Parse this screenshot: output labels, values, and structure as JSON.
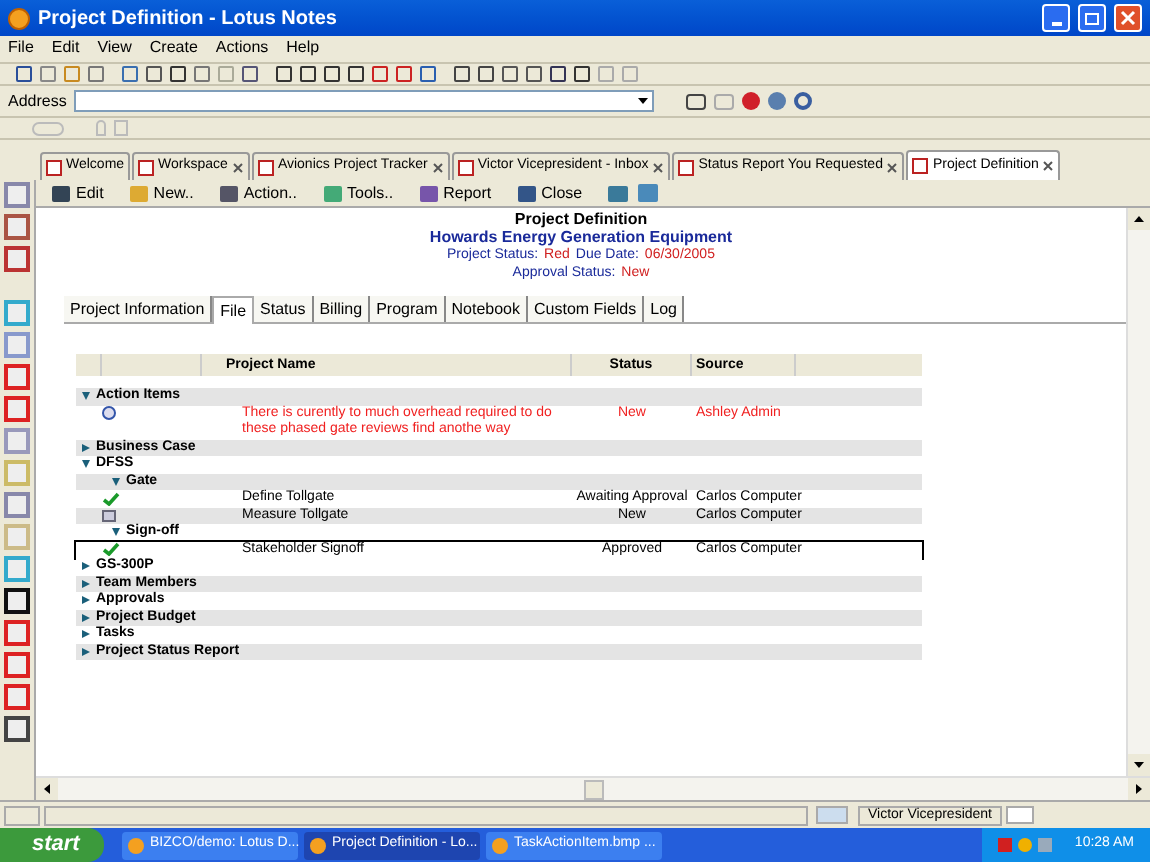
{
  "window": {
    "title": "Project Definition - Lotus Notes"
  },
  "menu": [
    "File",
    "Edit",
    "View",
    "Create",
    "Actions",
    "Help"
  ],
  "address": {
    "label": "Address"
  },
  "tabs": [
    {
      "label": "Welcome",
      "selected": false,
      "closable": false
    },
    {
      "label": "Workspace",
      "selected": false,
      "closable": true
    },
    {
      "label": "Avionics Project Tracker",
      "selected": false,
      "closable": true
    },
    {
      "label": "Victor Vicepresident - Inbox",
      "selected": false,
      "closable": true
    },
    {
      "label": "Status Report You Requested",
      "selected": false,
      "closable": true
    },
    {
      "label": "Project Definition",
      "selected": true,
      "closable": true
    }
  ],
  "actions": [
    {
      "label": "Edit"
    },
    {
      "label": "New.."
    },
    {
      "label": "Action.."
    },
    {
      "label": "Tools.."
    },
    {
      "label": "Report"
    },
    {
      "label": "Close"
    }
  ],
  "document": {
    "title": "Project Definition",
    "subtitle": "Howards Energy Generation Equipment",
    "status_label": "Project Status:",
    "status": "Red",
    "due_label": "Due Date:",
    "due": "06/30/2005",
    "approval_label": "Approval Status:",
    "approval": "New"
  },
  "subtabs": [
    {
      "label": "Project Information",
      "selected": false
    },
    {
      "label": "File",
      "selected": true
    },
    {
      "label": "Status",
      "selected": false
    },
    {
      "label": "Billing",
      "selected": false
    },
    {
      "label": "Program",
      "selected": false
    },
    {
      "label": "Notebook",
      "selected": false
    },
    {
      "label": "Custom Fields",
      "selected": false
    },
    {
      "label": "Log",
      "selected": false
    }
  ],
  "table": {
    "columns": [
      "Project Name",
      "Status",
      "Source"
    ],
    "rows": [
      {
        "kind": "category",
        "label": "Action Items",
        "expanded": true,
        "children": [
          {
            "kind": "alert",
            "name": "There is curently to much overhead required to do these phased gate reviews find anothe way",
            "status": "New",
            "source": "Ashley Admin",
            "selected": false
          }
        ]
      },
      {
        "kind": "category",
        "label": "Business Case",
        "expanded": false
      },
      {
        "kind": "category",
        "label": "DFSS",
        "expanded": true,
        "children": [
          {
            "kind": "category",
            "label": "Gate",
            "expanded": true,
            "children": [
              {
                "kind": "approved",
                "name": "Define Tollgate",
                "status": "Awaiting Approval",
                "source": "Carlos Computer",
                "selected": false
              },
              {
                "kind": "document",
                "name": "Measure Tollgate",
                "status": "New",
                "source": "Carlos Computer",
                "selected": false
              }
            ]
          },
          {
            "kind": "category",
            "label": "Sign-off",
            "expanded": true,
            "children": [
              {
                "kind": "approved",
                "name": "Stakeholder Signoff",
                "status": "Approved",
                "source": "Carlos Computer",
                "selected": true
              }
            ]
          }
        ]
      },
      {
        "kind": "category",
        "label": "GS-300P",
        "expanded": false
      },
      {
        "kind": "category",
        "label": "Team Members",
        "expanded": false
      },
      {
        "kind": "category",
        "label": "Approvals",
        "expanded": false
      },
      {
        "kind": "category",
        "label": "Project Budget",
        "expanded": false
      },
      {
        "kind": "category",
        "label": "Tasks",
        "expanded": false
      },
      {
        "kind": "category",
        "label": "Project Status Report",
        "expanded": false
      }
    ]
  },
  "status_bar": {
    "user": "Victor Vicepresident"
  },
  "taskbar": {
    "start": "start",
    "tasks": [
      {
        "label": "BIZCO/demo: Lotus D...",
        "selected": false
      },
      {
        "label": "Project Definition - Lo...",
        "selected": true
      },
      {
        "label": "TaskActionItem.bmp ...",
        "selected": false
      }
    ],
    "clock": "10:28 AM"
  }
}
